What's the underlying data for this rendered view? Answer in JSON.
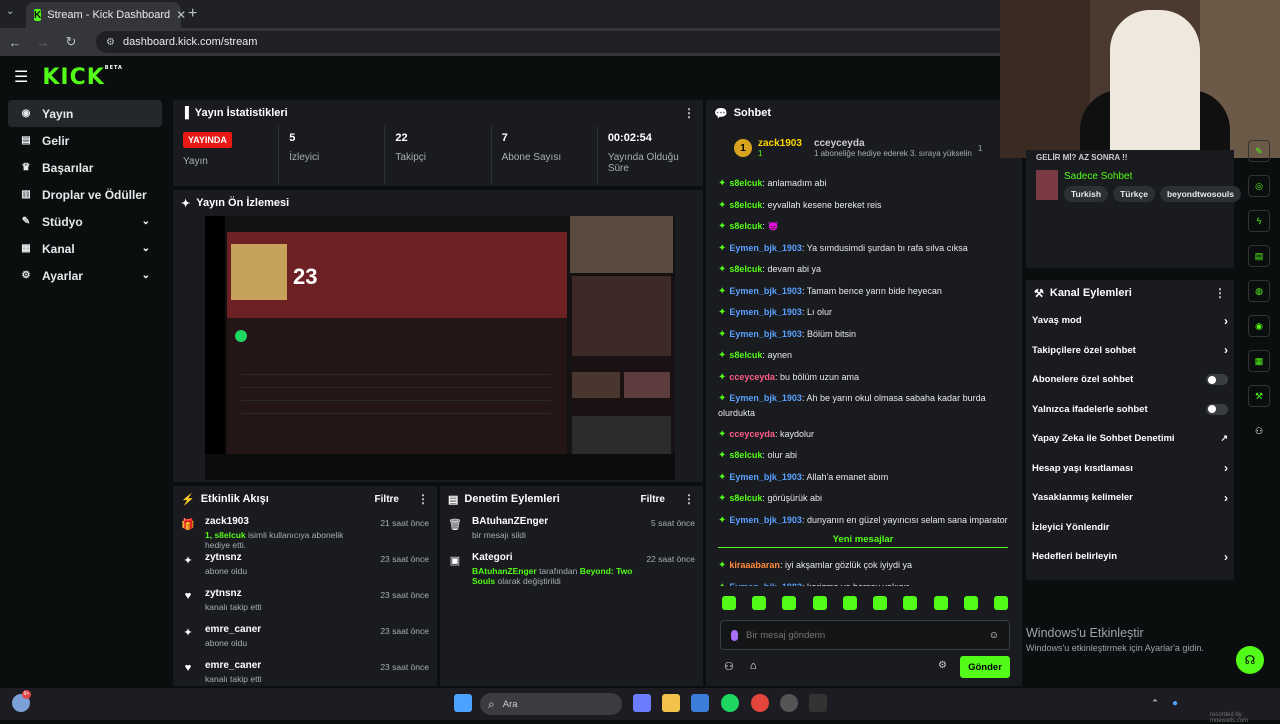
{
  "browser": {
    "tab_title": "Stream - Kick Dashboard",
    "url": "dashboard.kick.com/stream"
  },
  "brand": {
    "logo": "KICK",
    "badge": "BETA",
    "accent": "#53fc18"
  },
  "sidebar": {
    "items": [
      {
        "label": "Yayın",
        "icon": "broadcast-icon",
        "active": true
      },
      {
        "label": "Gelir",
        "icon": "revenue-icon"
      },
      {
        "label": "Başarılar",
        "icon": "trophy-icon"
      },
      {
        "label": "Droplar ve Ödüller",
        "icon": "gift-icon"
      },
      {
        "label": "Stüdyo",
        "icon": "studio-icon",
        "expandable": true
      },
      {
        "label": "Kanal",
        "icon": "channel-icon",
        "expandable": true
      },
      {
        "label": "Ayarlar",
        "icon": "settings-icon",
        "expandable": true
      }
    ]
  },
  "stats": {
    "title": "Yayın İstatistikleri",
    "live_badge": "YAYINDA",
    "live_label": "Yayın",
    "items": [
      {
        "value": "5",
        "label": "İzleyici"
      },
      {
        "value": "22",
        "label": "Takipçi"
      },
      {
        "value": "7",
        "label": "Abone Sayısı"
      },
      {
        "value": "00:02:54",
        "label": "Yayında Olduğu Süre"
      }
    ]
  },
  "preview": {
    "title": "Yayın Ön İzlemesi",
    "track_number": "23"
  },
  "activity": {
    "title": "Etkinlik Akışı",
    "filter": "Filtre",
    "rows": [
      {
        "name": "zack1903",
        "highlight": "1, s8elcuk",
        "desc": " isimli kullanıcıya abonelik hediye etti.",
        "time": "21 saat önce",
        "icon": "gift-icon"
      },
      {
        "name": "zytnsnz",
        "highlight": "",
        "desc": "abone oldu",
        "time": "23 saat önce",
        "icon": "sparkle-icon"
      },
      {
        "name": "zytnsnz",
        "highlight": "",
        "desc": "kanalı takip etti",
        "time": "23 saat önce",
        "icon": "heart-icon"
      },
      {
        "name": "emre_caner",
        "highlight": "",
        "desc": "abone oldu",
        "time": "23 saat önce",
        "icon": "sparkle-icon"
      },
      {
        "name": "emre_caner",
        "highlight": "",
        "desc": "kanalı takip etti",
        "time": "23 saat önce",
        "icon": "heart-icon"
      }
    ]
  },
  "moderation": {
    "title": "Denetim Eylemleri",
    "filter": "Filtre",
    "rows": [
      {
        "name": "BAtuhanZEnger",
        "desc": "bir mesajı sildi",
        "time": "5 saat önce",
        "icon": "trash-icon"
      },
      {
        "name": "Kategori",
        "hl1": "BAtuhanZEnger",
        "mid": " tarafından ",
        "hl2": "Beyond: Two Souls",
        "desc": " olarak değiştirildi",
        "time": "22 saat önce",
        "icon": "category-icon"
      }
    ]
  },
  "chat": {
    "title": "Sohbet",
    "pinned_user": "zack1903",
    "pinned_count": "1",
    "pinned_user2": "cceyceyda",
    "pinned_count2": "1",
    "pinned_text": "1 aboneliğe hediye ederek 3. sıraya yükselin",
    "messages": [
      {
        "user": "s8elcuk",
        "color": "green",
        "text": "anlamadım abi"
      },
      {
        "user": "s8elcuk",
        "color": "green",
        "text": "eyvallah kesene bereket reis"
      },
      {
        "user": "s8elcuk",
        "color": "green",
        "text": "😈"
      },
      {
        "user": "Eymen_bjk_1903",
        "color": "blue",
        "text": "Ya sımdusimdi şurdan bı rafa sılva cıksa"
      },
      {
        "user": "s8elcuk",
        "color": "green",
        "text": "devam abi ya"
      },
      {
        "user": "Eymen_bjk_1903",
        "color": "blue",
        "text": "Tamam bence yarın bide heyecan"
      },
      {
        "user": "Eymen_bjk_1903",
        "color": "blue",
        "text": "Lı olur"
      },
      {
        "user": "Eymen_bjk_1903",
        "color": "blue",
        "text": "Bölüm bitsin"
      },
      {
        "user": "s8elcuk",
        "color": "green",
        "text": "aynen"
      },
      {
        "user": "cceyceyda",
        "color": "pink",
        "text": "bu bölüm uzun ama"
      },
      {
        "user": "Eymen_bjk_1903",
        "color": "blue",
        "text": "Ah be yarın okul olmasa sabaha kadar burda olurdukta"
      },
      {
        "user": "cceyceyda",
        "color": "pink",
        "text": "kaydolur"
      },
      {
        "user": "s8elcuk",
        "color": "green",
        "text": "olur abi"
      },
      {
        "user": "Eymen_bjk_1903",
        "color": "blue",
        "text": "Allah'a emanet abım"
      },
      {
        "user": "s8elcuk",
        "color": "green",
        "text": "görüşürük abi"
      },
      {
        "user": "Eymen_bjk_1903",
        "color": "blue",
        "text": "dunyanın en güzel yayıncısı selam sana imparator"
      }
    ],
    "new_messages_label": "Yeni mesajlar",
    "new_messages": [
      {
        "user": "kiraaabaran",
        "color": "orange",
        "text": "iyi akşamlar gözlük çok iyiydi ya"
      },
      {
        "user": "Eymen_bjk_1903",
        "color": "blue",
        "text": "karizma ya herşey yakışır"
      }
    ],
    "input_placeholder": "Bir mesaj gönderin",
    "send_label": "Gönder"
  },
  "stream_info": {
    "title": "GELİR Mİ? AZ SONRA !!",
    "game": "Sadece Sohbet",
    "tags": [
      "Turkish",
      "Türkçe",
      "beyondtwosouls"
    ]
  },
  "channel_actions": {
    "title": "Kanal Eylemleri",
    "rows": [
      {
        "label": "Yavaş mod",
        "control": "arrow"
      },
      {
        "label": "Takipçilere özel sohbet",
        "control": "arrow"
      },
      {
        "label": "Abonelere özel sohbet",
        "control": "toggle"
      },
      {
        "label": "Yalnızca ifadelerle sohbet",
        "control": "toggle"
      },
      {
        "label": "Yapay Zeka ile Sohbet Denetimi",
        "control": "external"
      },
      {
        "label": "Hesap yaşı kısıtlaması",
        "control": "arrow"
      },
      {
        "label": "Yasaklanmış kelimeler",
        "control": "arrow"
      },
      {
        "label": "İzleyici Yönlendir",
        "control": "none"
      },
      {
        "label": "Hedefleri belirleyin",
        "control": "arrow"
      }
    ]
  },
  "windows": {
    "activation_title": "Windows'u Etkinleştir",
    "activation_text": "Windows'u etkinleştirmek için Ayarlar'a gidin.",
    "search_placeholder": "Ara",
    "notification_badge": "9+",
    "recorder": "recorded by moewalls.com"
  }
}
